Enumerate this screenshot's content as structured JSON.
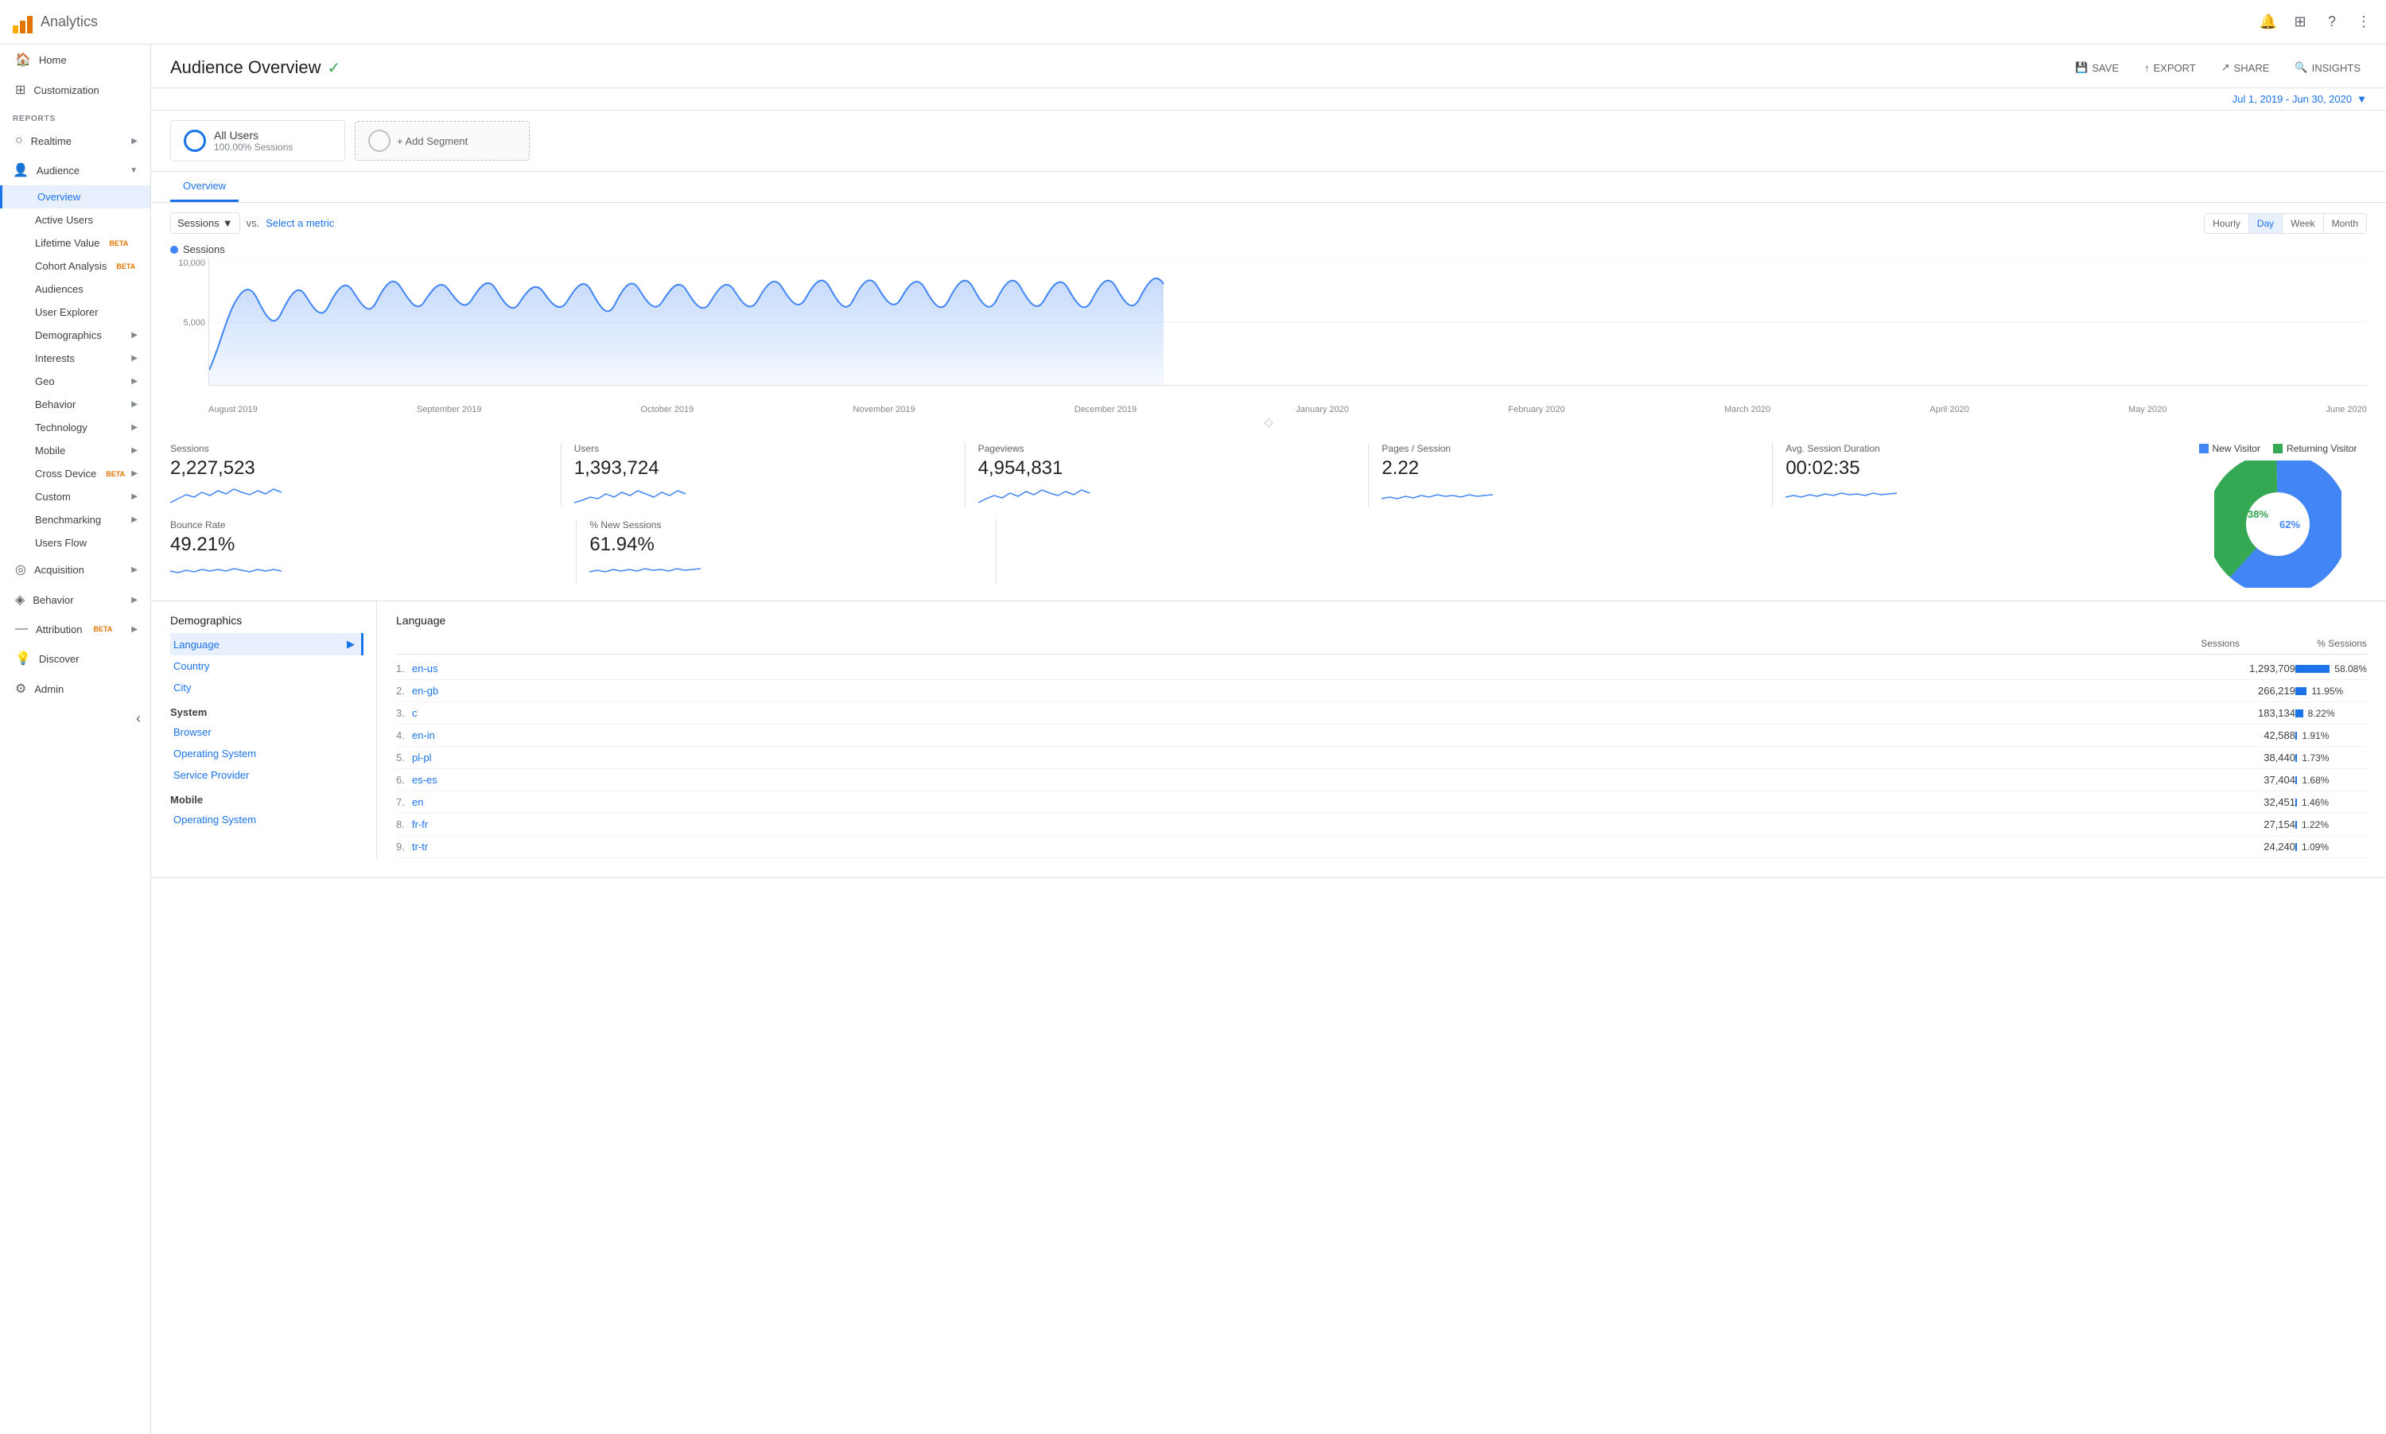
{
  "app": {
    "name": "Analytics",
    "logo_bars": [
      {
        "height": 10,
        "color": "#f9ab00"
      },
      {
        "height": 16,
        "color": "#e37400"
      },
      {
        "height": 22,
        "color": "#e37400"
      }
    ]
  },
  "topbar": {
    "icons": [
      "notifications",
      "apps_grid",
      "help",
      "more_vert"
    ]
  },
  "sidebar": {
    "nav_items": [
      {
        "id": "home",
        "label": "Home",
        "icon": "🏠",
        "indent": false
      },
      {
        "id": "customization",
        "label": "Customization",
        "icon": "⊞",
        "indent": false
      }
    ],
    "reports_label": "REPORTS",
    "reports_items": [
      {
        "id": "realtime",
        "label": "Realtime",
        "icon": "○",
        "indent": false,
        "expandable": true
      },
      {
        "id": "audience",
        "label": "Audience",
        "icon": "👤",
        "indent": false,
        "expandable": true,
        "expanded": true
      },
      {
        "id": "overview",
        "label": "Overview",
        "indent": true,
        "active": true
      },
      {
        "id": "active-users",
        "label": "Active Users",
        "indent": true
      },
      {
        "id": "lifetime-value",
        "label": "Lifetime Value",
        "indent": true,
        "beta": true
      },
      {
        "id": "cohort-analysis",
        "label": "Cohort Analysis",
        "indent": true,
        "beta": true
      },
      {
        "id": "audiences",
        "label": "Audiences",
        "indent": true
      },
      {
        "id": "user-explorer",
        "label": "User Explorer",
        "indent": true
      },
      {
        "id": "demographics",
        "label": "Demographics",
        "indent": true,
        "expandable": true
      },
      {
        "id": "interests",
        "label": "Interests",
        "indent": true,
        "expandable": true
      },
      {
        "id": "geo",
        "label": "Geo",
        "indent": true,
        "expandable": true
      },
      {
        "id": "behavior",
        "label": "Behavior",
        "indent": true,
        "expandable": true
      },
      {
        "id": "technology",
        "label": "Technology",
        "indent": true,
        "expandable": true
      },
      {
        "id": "mobile",
        "label": "Mobile",
        "indent": true,
        "expandable": true
      },
      {
        "id": "cross-device",
        "label": "Cross Device",
        "indent": true,
        "expandable": true,
        "beta": true
      },
      {
        "id": "custom",
        "label": "Custom",
        "indent": true,
        "expandable": true
      },
      {
        "id": "benchmarking",
        "label": "Benchmarking",
        "indent": true,
        "expandable": true
      },
      {
        "id": "users-flow",
        "label": "Users Flow",
        "indent": true
      }
    ],
    "bottom_items": [
      {
        "id": "acquisition",
        "label": "Acquisition",
        "icon": "◎",
        "expandable": true
      },
      {
        "id": "behavior",
        "label": "Behavior",
        "icon": "◈",
        "expandable": true
      },
      {
        "id": "attribution",
        "label": "Attribution",
        "icon": "—",
        "expandable": true,
        "beta": true
      },
      {
        "id": "discover",
        "label": "Discover",
        "icon": "💡"
      },
      {
        "id": "admin",
        "label": "Admin",
        "icon": "⚙"
      }
    ]
  },
  "page": {
    "title": "Audience Overview",
    "verified": true,
    "actions": {
      "save": "SAVE",
      "export": "EXPORT",
      "share": "SHARE",
      "insights": "INSIGHTS"
    },
    "date_range": "Jul 1, 2019 - Jun 30, 2020",
    "segments": [
      {
        "label": "All Users",
        "sub": "100.00% Sessions"
      }
    ],
    "add_segment": "+ Add Segment",
    "tabs": [
      "Overview"
    ]
  },
  "chart": {
    "metric_label": "Sessions",
    "vs_label": "vs.",
    "select_metric": "Select a metric",
    "time_buttons": [
      "Hourly",
      "Day",
      "Week",
      "Month"
    ],
    "active_time": "Day",
    "y_labels": [
      "10,000",
      "5,000"
    ],
    "x_labels": [
      "August 2019",
      "September 2019",
      "October 2019",
      "November 2019",
      "December 2019",
      "January 2020",
      "February 2020",
      "March 2020",
      "April 2020",
      "May 2020",
      "June 2020"
    ],
    "legend": "Sessions",
    "legend_color": "#4285f4"
  },
  "metrics": [
    {
      "label": "Sessions",
      "value": "2,227,523"
    },
    {
      "label": "Users",
      "value": "1,393,724"
    },
    {
      "label": "Pageviews",
      "value": "4,954,831"
    },
    {
      "label": "Pages / Session",
      "value": "2.22"
    },
    {
      "label": "Avg. Session Duration",
      "value": "00:02:35"
    }
  ],
  "metrics2": [
    {
      "label": "Bounce Rate",
      "value": "49.21%"
    },
    {
      "label": "% New Sessions",
      "value": "61.94%"
    }
  ],
  "pie_chart": {
    "new_visitor_pct": 62,
    "returning_visitor_pct": 38,
    "new_visitor_label": "New Visitor",
    "returning_visitor_label": "Returning Visitor",
    "new_visitor_color": "#4285f4",
    "returning_visitor_color": "#34a853"
  },
  "demographics": {
    "title": "Demographics",
    "left_links": [
      {
        "label": "Language",
        "active": true
      },
      {
        "label": "Country"
      },
      {
        "label": "City"
      }
    ],
    "system_title": "System",
    "system_links": [
      {
        "label": "Browser"
      },
      {
        "label": "Operating System"
      },
      {
        "label": "Service Provider"
      }
    ],
    "mobile_title": "Mobile",
    "mobile_links": [
      {
        "label": "Operating System"
      }
    ],
    "right_title": "Language",
    "col_sessions": "Sessions",
    "col_pct_sessions": "% Sessions",
    "rows": [
      {
        "num": "1.",
        "link": "en-us",
        "sessions": "1,293,709",
        "bar_pct": 58,
        "pct": "58.08%"
      },
      {
        "num": "2.",
        "link": "en-gb",
        "sessions": "266,219",
        "bar_pct": 12,
        "pct": "11.95%"
      },
      {
        "num": "3.",
        "link": "c",
        "sessions": "183,134",
        "bar_pct": 8,
        "pct": "8.22%"
      },
      {
        "num": "4.",
        "link": "en-in",
        "sessions": "42,588",
        "bar_pct": 2,
        "pct": "1.91%"
      },
      {
        "num": "5.",
        "link": "pl-pl",
        "sessions": "38,440",
        "bar_pct": 2,
        "pct": "1.73%"
      },
      {
        "num": "6.",
        "link": "es-es",
        "sessions": "37,404",
        "bar_pct": 2,
        "pct": "1.68%"
      },
      {
        "num": "7.",
        "link": "en",
        "sessions": "32,451",
        "bar_pct": 1,
        "pct": "1.46%"
      },
      {
        "num": "8.",
        "link": "fr-fr",
        "sessions": "27,154",
        "bar_pct": 1,
        "pct": "1.22%"
      },
      {
        "num": "9.",
        "link": "tr-tr",
        "sessions": "24,240",
        "bar_pct": 1,
        "pct": "1.09%"
      }
    ]
  }
}
